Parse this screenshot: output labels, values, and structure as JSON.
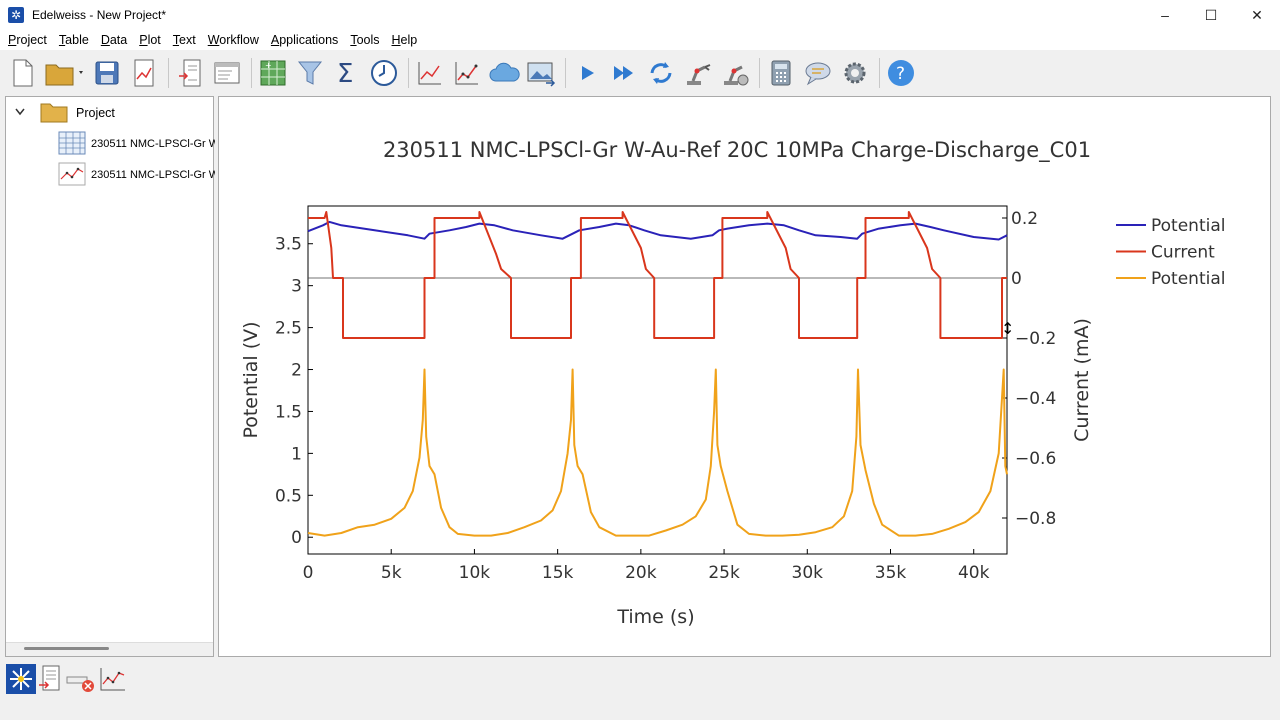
{
  "window": {
    "title": "Edelweiss - New Project*",
    "controls": [
      "–",
      "☐",
      "✕"
    ]
  },
  "menu": [
    {
      "label": "Project",
      "u": "P"
    },
    {
      "label": "Table",
      "u": "T"
    },
    {
      "label": "Data",
      "u": "D"
    },
    {
      "label": "Plot",
      "u": "P"
    },
    {
      "label": "Text",
      "u": "T"
    },
    {
      "label": "Workflow",
      "u": "W"
    },
    {
      "label": "Applications",
      "u": "A"
    },
    {
      "label": "Tools",
      "u": "T"
    },
    {
      "label": "Help",
      "u": "H"
    }
  ],
  "toolbar": {
    "icons": [
      "new-file-icon",
      "open-folder-icon",
      "save-icon",
      "export-plot-icon",
      "import-icon",
      "preview-icon",
      "table-calc-icon",
      "filter-icon",
      "sigma-icon",
      "clock-icon",
      "line-plot-icon",
      "scatter-plot-icon",
      "cloud-icon",
      "image-icon",
      "play-icon",
      "fast-forward-icon",
      "refresh-icon",
      "robot-arm-icon",
      "robot-arm-settings-icon",
      "calculator-icon",
      "chat-icon",
      "gear-icon",
      "help-icon"
    ]
  },
  "tree": {
    "root": "Project",
    "items": [
      {
        "label": "230511 NMC-LPSCl-Gr W",
        "icon": "table-icon"
      },
      {
        "label": "230511 NMC-LPSCl-Gr W",
        "icon": "plot-icon"
      }
    ]
  },
  "colors": {
    "series1": "#2a22b8",
    "series2": "#d9361c",
    "series3": "#f0a21a",
    "axis": "#000000"
  },
  "chart_data": {
    "type": "line",
    "title": "230511 NMC-LPSCl-Gr W-Au-Ref 20C 10MPa Charge-Discharge_C01",
    "xlabel": "Time (s)",
    "ylabel": "Potential (V)",
    "y2label": "Current (mA)",
    "xlim": [
      0,
      42000
    ],
    "ylim": [
      -0.2,
      3.95
    ],
    "y2lim": [
      -0.92,
      0.24
    ],
    "xticks": [
      0,
      5000,
      10000,
      15000,
      20000,
      25000,
      30000,
      35000,
      40000
    ],
    "xtick_labels": [
      "0",
      "5k",
      "10k",
      "15k",
      "20k",
      "25k",
      "30k",
      "35k",
      "40k"
    ],
    "yticks": [
      0,
      0.5,
      1,
      1.5,
      2,
      2.5,
      3,
      3.5
    ],
    "ytick_labels": [
      "0",
      "0.5",
      "1",
      "1.5",
      "2",
      "2.5",
      "3",
      "3.5"
    ],
    "y2ticks": [
      0.2,
      0,
      -0.2,
      -0.4,
      -0.6,
      -0.8
    ],
    "y2tick_labels": [
      "0.2",
      "0",
      "−0.2",
      "−0.4",
      "−0.6",
      "−0.8"
    ],
    "legend_position": "right",
    "series": [
      {
        "name": "Potential",
        "axis": "left",
        "color": "#2a22b8",
        "x": [
          0,
          900,
          1300,
          2000,
          4000,
          6000,
          7000,
          7300,
          8500,
          9500,
          10300,
          11200,
          12300,
          14000,
          15300,
          15900,
          16300,
          17500,
          18500,
          19300,
          20200,
          21200,
          23000,
          24300,
          24700,
          25200,
          26500,
          27600,
          28600,
          29500,
          30500,
          32000,
          33000,
          33300,
          34300,
          35600,
          36500,
          37400,
          38200,
          40000,
          41500,
          42000
        ],
        "y": [
          3.65,
          3.72,
          3.76,
          3.72,
          3.66,
          3.6,
          3.56,
          3.62,
          3.66,
          3.7,
          3.74,
          3.72,
          3.66,
          3.6,
          3.56,
          3.62,
          3.66,
          3.7,
          3.74,
          3.72,
          3.66,
          3.6,
          3.56,
          3.6,
          3.66,
          3.68,
          3.72,
          3.74,
          3.72,
          3.66,
          3.6,
          3.58,
          3.56,
          3.62,
          3.68,
          3.72,
          3.74,
          3.7,
          3.66,
          3.58,
          3.55,
          3.6
        ]
      },
      {
        "name": "Current",
        "axis": "right",
        "color": "#d9361c",
        "x": [
          0,
          1000,
          1100,
          1400,
          1500,
          2100,
          2100,
          7000,
          7000,
          7600,
          7600,
          10300,
          10300,
          11300,
          11600,
          12200,
          12200,
          15800,
          15800,
          16400,
          16400,
          18900,
          18900,
          20000,
          20300,
          20800,
          20800,
          24400,
          24400,
          24900,
          24900,
          27600,
          27600,
          28700,
          29000,
          29500,
          29500,
          33000,
          33000,
          33500,
          33500,
          36100,
          36100,
          37200,
          37500,
          38000,
          38000,
          41700,
          41700,
          42000
        ],
        "y": [
          0.2,
          0.2,
          0.22,
          0.1,
          0,
          0,
          -0.2,
          -0.2,
          0,
          0,
          0.2,
          0.2,
          0.22,
          0.08,
          0.03,
          0,
          -0.2,
          -0.2,
          0,
          0,
          0.2,
          0.2,
          0.22,
          0.1,
          0.03,
          0,
          -0.2,
          -0.2,
          0,
          0,
          0.2,
          0.2,
          0.22,
          0.1,
          0.03,
          0,
          -0.2,
          -0.2,
          0,
          0,
          0.2,
          0.2,
          0.22,
          0.1,
          0.03,
          0,
          -0.2,
          -0.2,
          0,
          0
        ]
      },
      {
        "name": "Potential",
        "axis": "left",
        "color": "#f0a21a",
        "x": [
          0,
          1000,
          2000,
          3000,
          4000,
          5000,
          5800,
          6300,
          6700,
          6900,
          7000,
          7100,
          7300,
          7600,
          8000,
          8500,
          9000,
          10000,
          11000,
          12000,
          13000,
          14000,
          14700,
          15200,
          15600,
          15800,
          15900,
          16000,
          16200,
          16500,
          17000,
          17500,
          18500,
          19500,
          20500,
          21500,
          22500,
          23300,
          23900,
          24200,
          24400,
          24500,
          24600,
          24800,
          25200,
          25800,
          26500,
          27500,
          28500,
          29500,
          30500,
          31500,
          32200,
          32700,
          32950,
          33050,
          33200,
          33500,
          34000,
          34500,
          35500,
          36500,
          37500,
          38500,
          39500,
          40300,
          41000,
          41500,
          41800,
          41900,
          42000
        ],
        "y": [
          0.05,
          0.02,
          0.05,
          0.12,
          0.15,
          0.22,
          0.35,
          0.55,
          0.95,
          1.4,
          2.0,
          1.2,
          0.85,
          0.75,
          0.35,
          0.12,
          0.04,
          0.02,
          0.02,
          0.05,
          0.12,
          0.2,
          0.32,
          0.55,
          1.0,
          1.4,
          2.0,
          1.1,
          0.85,
          0.75,
          0.3,
          0.12,
          0.02,
          0.02,
          0.02,
          0.08,
          0.15,
          0.25,
          0.45,
          0.85,
          1.5,
          2.0,
          1.1,
          0.85,
          0.55,
          0.15,
          0.04,
          0.02,
          0.02,
          0.03,
          0.06,
          0.12,
          0.25,
          0.55,
          1.2,
          2.0,
          1.1,
          0.8,
          0.4,
          0.15,
          0.02,
          0.02,
          0.04,
          0.1,
          0.18,
          0.3,
          0.55,
          1.0,
          2.0,
          0.85,
          0.75
        ]
      }
    ]
  }
}
